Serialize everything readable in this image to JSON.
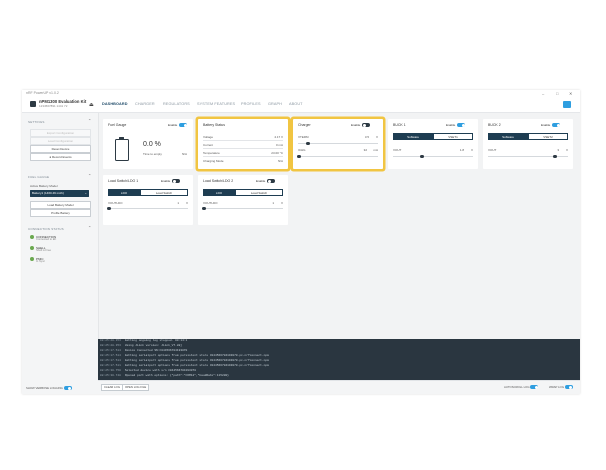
{
  "window": {
    "title": "nRF PowerUP v1.0.2",
    "minimize": "–",
    "maximize": "□",
    "close": "✕"
  },
  "header": {
    "device_name": "nPM1300 Evaluation Kit",
    "device_serial": "1234567891 1441 72",
    "tabs": [
      {
        "label": "DASHBOARD",
        "active": true
      },
      {
        "label": "CHARGER",
        "active": false
      },
      {
        "label": "REGULATORS",
        "active": false
      },
      {
        "label": "SYSTEM FEATURES",
        "active": false
      },
      {
        "label": "PROFILES",
        "active": false
      },
      {
        "label": "GRAPH",
        "active": false
      },
      {
        "label": "ABOUT",
        "active": false
      }
    ]
  },
  "sidebar": {
    "settings": {
      "heading": "SETTINGS",
      "buttons": [
        "Export Configuration",
        "Load Configuration",
        "Reset Device",
        "Record Events"
      ]
    },
    "fuel_gauge": {
      "heading": "FUEL GAUGE",
      "active_label": "Active Battery Model",
      "selected_model": "Battery1 (1460.49 mAh)",
      "buttons": [
        "Load Battery Model",
        "Profile Battery"
      ]
    },
    "connection": {
      "heading": "CONNECTION STATUS",
      "items": [
        {
          "title": "CONNECTION",
          "sub": "Connected to EK"
        },
        {
          "title": "SHELL",
          "sub": "Shell is Free"
        },
        {
          "title": "PMIC",
          "sub": "In Sync"
        }
      ]
    },
    "verbose_label": "SHOW VERBOSE LOGGING"
  },
  "cards": {
    "fuel_gauge": {
      "title": "Fuel Gauge",
      "enable": "Enable",
      "percent": "0.0 %",
      "tte_label": "Time to empty",
      "tte_value": "N/A"
    },
    "battery_status": {
      "title": "Battery Status",
      "rows": [
        {
          "label": "Voltage",
          "value": "4.17 V"
        },
        {
          "label": "Current",
          "value": "0 mA"
        },
        {
          "label": "Temperature",
          "value": "23.00 °C"
        },
        {
          "label": "Charging Mode",
          "value": "N/A"
        }
      ]
    },
    "charger": {
      "title": "Charger",
      "enable": "Enable",
      "vterm_label": "VTERM",
      "vterm_value": "3.5",
      "vterm_unit": "V",
      "ichg_label": "ICHG",
      "ichg_value": "32",
      "ichg_unit": "mA"
    },
    "buck1": {
      "title": "BUCK 1",
      "enable": "Enable",
      "seg_software": "Software",
      "seg_vset": "VSET1",
      "vout_label": "VOUT",
      "vout_value": "1.8",
      "vout_unit": "V"
    },
    "buck2": {
      "title": "BUCK 2",
      "enable": "Enable",
      "seg_software": "Software",
      "seg_vset": "VSET2",
      "vout_label": "VOUT",
      "vout_value": "3",
      "vout_unit": "V"
    },
    "ldo1": {
      "title": "Load Switch/LDO 1",
      "enable": "Enable",
      "seg_ldo": "LDO",
      "seg_switch": "Load Switch",
      "vout_label": "VOUTLDO",
      "vout_value": "1",
      "vout_unit": "V"
    },
    "ldo2": {
      "title": "Load Switch/LDO 2",
      "enable": "Enable",
      "seg_ldo": "LDO",
      "seg_switch": "Load Switch",
      "vout_label": "VOUTLDO",
      "vout_value": "1",
      "vout_unit": "V"
    }
  },
  "log": [
    {
      "ts": "08:25:28.353",
      "msg": "Getting ongoing log stopped. 00:14:1"
    },
    {
      "ts": "08:25:28.353",
      "msg": "Using JLink version: JLink_V7.88j"
    },
    {
      "ts": "08:25:17.514",
      "msg": "Device Connected SN:C044566704193070"
    },
    {
      "ts": "08:25:17.514",
      "msg": "Getting serialport options from persistent store C044566704193070.pc-nrfconnect-npm"
    },
    {
      "ts": "08:25:17.514",
      "msg": "Getting serialport options from persistent store C044566704193070.pc-nrfconnect-npm"
    },
    {
      "ts": "08:25:17.511",
      "msg": "Getting serialport options from persistent store C044566704193070.pc-nrfconnect-npm"
    },
    {
      "ts": "08:25:30.750",
      "msg": "Selected device with s/n C044566704193070"
    },
    {
      "ts": "08:25:30.748",
      "msg": "Opened port with options: {\"path\":\"COM12\",\"baudRate\":115200}"
    }
  ],
  "footer": {
    "buttons": [
      "CLEAR LOG",
      "OPEN LOG FILE"
    ],
    "autoscroll": "AUTOSCROLL LOG",
    "wrap": "WRAP LOG"
  },
  "colors": {
    "accent": "#2e9ee0",
    "dark": "#1e3d52",
    "highlight": "#f1c542"
  }
}
